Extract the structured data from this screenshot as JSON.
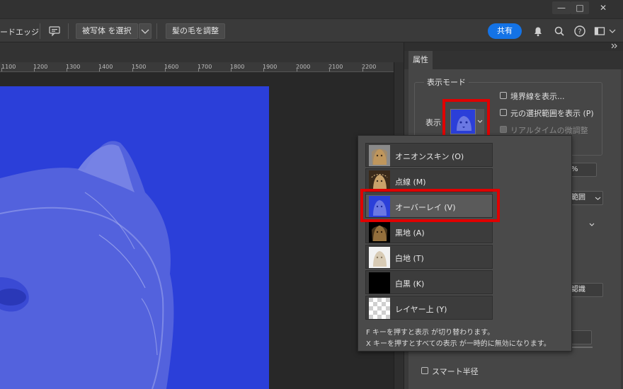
{
  "window": {
    "minimize": "—",
    "maximize": "□",
    "close": "✕"
  },
  "options_bar": {
    "refine_edge_label": "ードエッジ",
    "select_subject_label": "被写体 を選択",
    "refine_hair_label": "髪の毛を調整",
    "share_label": "共有"
  },
  "ruler": {
    "labels": [
      "1100",
      "1200",
      "1300",
      "1400",
      "1500",
      "1600",
      "1700",
      "1800",
      "1900",
      "2000",
      "2100",
      "2200"
    ]
  },
  "panel": {
    "tab_label": "属性",
    "view_mode_title": "表示モード",
    "view_label": "表示",
    "show_edge_label": "境界線を表示...",
    "show_original_label": "元の選択範囲を表示 (P)",
    "realtime_label": "リアルタイムの微調整",
    "percent_field": "%",
    "range_field": "範囲",
    "recognition_field": "認識",
    "smart_radius_label": "スマート半径"
  },
  "popup": {
    "items": [
      {
        "label": "オニオンスキン (O)",
        "thumb": "onion-skin"
      },
      {
        "label": "点線 (M)",
        "thumb": "marching-ants"
      },
      {
        "label": "オーバーレイ (V)",
        "thumb": "overlay"
      },
      {
        "label": "黒地 (A)",
        "thumb": "on-black"
      },
      {
        "label": "白地 (T)",
        "thumb": "on-white"
      },
      {
        "label": "白黒 (K)",
        "thumb": "black-white"
      },
      {
        "label": "レイヤー上 (Y)",
        "thumb": "on-layers"
      }
    ],
    "selected_index": 2,
    "note_1": "F キーを押すと表示 が切り替わります。",
    "note_2": "X キーを押すとすべての表示 が一時的に無効になります。"
  },
  "colors": {
    "overlay_blue": "#2b3fd9",
    "highlight_red": "#e00000",
    "share_blue": "#1473e6"
  },
  "icons": [
    "speech-bubble-icon",
    "bell-icon",
    "search-icon",
    "help-icon",
    "workspace-icon",
    "chevron-down-icon",
    "collapse-arrows-icon"
  ]
}
